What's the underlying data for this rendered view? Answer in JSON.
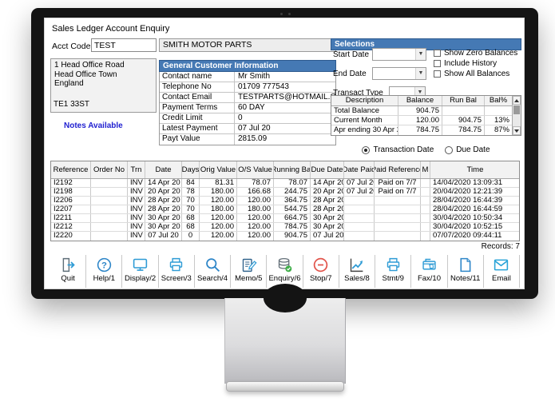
{
  "colors": {
    "header-blue": "#4579b4",
    "selection-blue": "#3d7ebd",
    "link-blue": "#1f1fd0",
    "icon-blue": "#2e9bd5",
    "stop-red": "#e2544b"
  },
  "window": {
    "title": "Sales Ledger Account Enquiry"
  },
  "account": {
    "acct_code_label": "Acct Code",
    "acct_code_value": "TEST",
    "account_name": "SMITH MOTOR PARTS",
    "address_lines": [
      "1 Head Office Road",
      "Head Office Town",
      "England"
    ],
    "postcode": "TE1 33ST",
    "notes_link": "Notes Available"
  },
  "customer_info": {
    "header": "General Customer Information",
    "rows": [
      [
        "Contact name",
        "Mr Smith"
      ],
      [
        "Telephone No",
        "01709 777543"
      ],
      [
        "Contact Email",
        "TESTPARTS@HOTMAIL.COM"
      ],
      [
        "Payment Terms",
        "60 DAY"
      ],
      [
        "Credit Limit",
        "0"
      ],
      [
        "Latest Payment",
        "07 Jul 20"
      ],
      [
        "Payt Value",
        "2815.09"
      ]
    ]
  },
  "selections": {
    "header": "Selections",
    "start_date_label": "Start Date",
    "end_date_label": "End Date",
    "transact_type_label": "Transact Type",
    "checkbox_labels": [
      "Show Zero Balances",
      "Include History",
      "Show All Balances"
    ]
  },
  "balances": {
    "columns": [
      "Description",
      "Balance",
      "Run Bal",
      "Bal%"
    ],
    "rows": [
      [
        "Total Balance",
        "904.75",
        "",
        ""
      ],
      [
        "Current Month",
        "120.00",
        "904.75",
        "13%"
      ],
      [
        "Apr ending 30 Apr 2",
        "784.75",
        "784.75",
        "87%"
      ]
    ]
  },
  "date_mode": {
    "options": [
      {
        "label": "Transaction Date",
        "selected": true
      },
      {
        "label": "Due Date",
        "selected": false
      }
    ]
  },
  "transactions": {
    "columns": [
      "Reference",
      "Order No",
      "Trn",
      "Date",
      "Days",
      "Orig Value",
      "O/S Value",
      "Running Bal",
      "Due Date",
      "Date Paid",
      "Paid Reference",
      "M",
      "Time"
    ],
    "rows": [
      [
        "I2192",
        "",
        "INV",
        "14 Apr 20",
        "84",
        "81.31",
        "78.07",
        "78.07",
        "14 Apr 20",
        "07 Jul 20",
        "Paid on 7/7",
        "",
        "14/04/2020 13:09:31"
      ],
      [
        "I2198",
        "",
        "INV",
        "20 Apr 20",
        "78",
        "180.00",
        "166.68",
        "244.75",
        "20 Apr 20",
        "07 Jul 20",
        "Paid on 7/7",
        "",
        "20/04/2020 12:21:39"
      ],
      [
        "I2206",
        "",
        "INV",
        "28 Apr 20",
        "70",
        "120.00",
        "120.00",
        "364.75",
        "28 Apr 20",
        "",
        "",
        "",
        "28/04/2020 16:44:39"
      ],
      [
        "I2207",
        "",
        "INV",
        "28 Apr 20",
        "70",
        "180.00",
        "180.00",
        "544.75",
        "28 Apr 20",
        "",
        "",
        "",
        "28/04/2020 16:44:59"
      ],
      [
        "I2211",
        "",
        "INV",
        "30 Apr 20",
        "68",
        "120.00",
        "120.00",
        "664.75",
        "30 Apr 20",
        "",
        "",
        "",
        "30/04/2020 10:50:34"
      ],
      [
        "I2212",
        "",
        "INV",
        "30 Apr 20",
        "68",
        "120.00",
        "120.00",
        "784.75",
        "30 Apr 20",
        "",
        "",
        "",
        "30/04/2020 10:52:15"
      ],
      [
        "I2220",
        "",
        "INV",
        "07 Jul 20",
        "0",
        "120.00",
        "120.00",
        "904.75",
        "07 Jul 20",
        "",
        "",
        "",
        "07/07/2020 09:44:11"
      ]
    ],
    "records_label": "Records: 7"
  },
  "toolbar": {
    "buttons": [
      {
        "label": "Quit"
      },
      {
        "label": "Help/1"
      },
      {
        "label": "Display/2"
      },
      {
        "label": "Screen/3"
      },
      {
        "label": "Search/4"
      },
      {
        "label": "Memo/5"
      },
      {
        "label": "Enquiry/6"
      },
      {
        "label": "Stop/7"
      },
      {
        "label": "Sales/8"
      },
      {
        "label": "Stmt/9"
      },
      {
        "label": "Fax/10"
      },
      {
        "label": "Notes/11"
      },
      {
        "label": "Email"
      }
    ]
  }
}
